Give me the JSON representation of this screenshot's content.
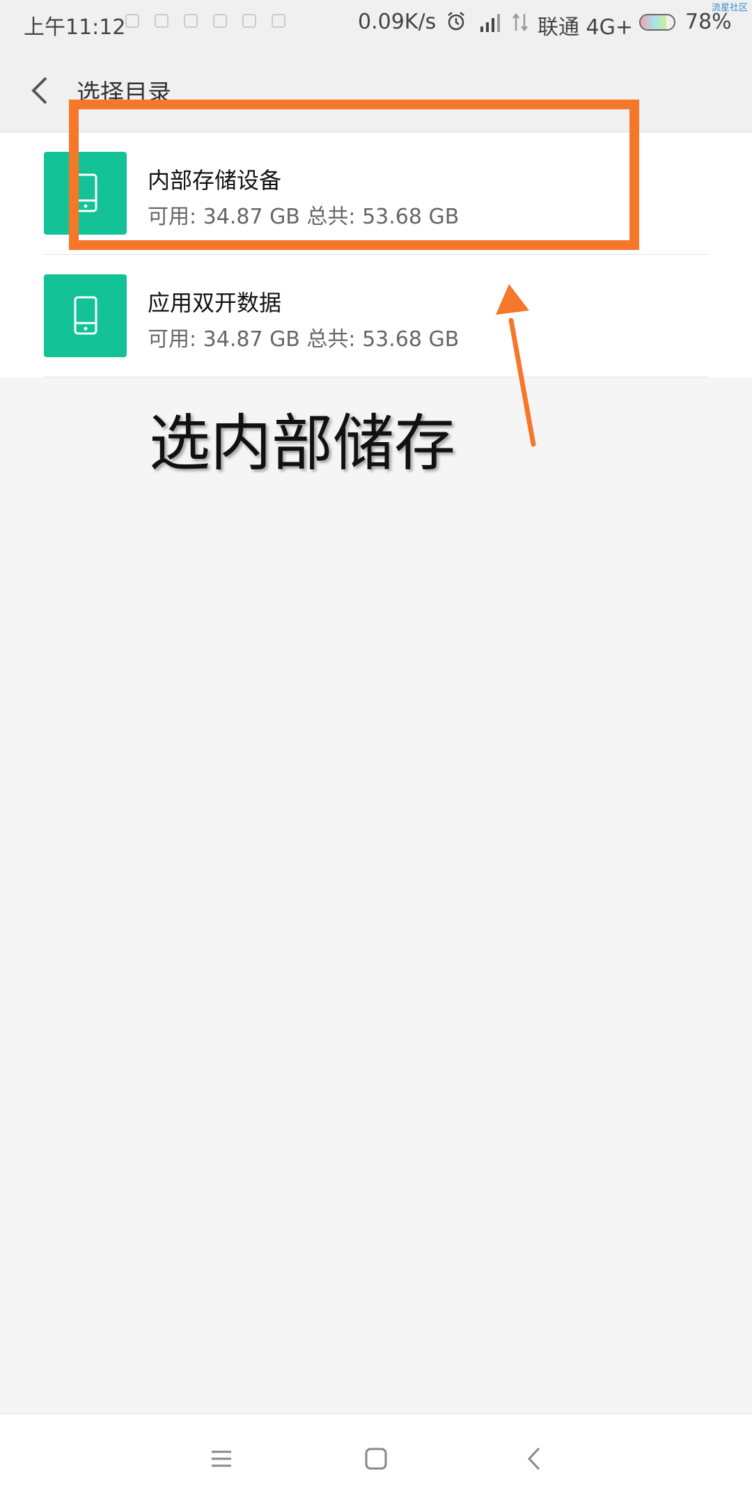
{
  "status_bar": {
    "time": "上午11:12",
    "network_speed": "0.09K/s",
    "carrier": "联通 4G+",
    "battery_percent": "78%",
    "battery_level": 0.78
  },
  "watermark": "流星社区",
  "header": {
    "title": "选择目录"
  },
  "storage_list": [
    {
      "name": "内部存储设备",
      "info": "可用: 34.87 GB 总共: 53.68 GB",
      "icon": "phone-icon"
    },
    {
      "name": "应用双开数据",
      "info": "可用: 34.87 GB 总共: 53.68 GB",
      "icon": "phone-icon"
    }
  ],
  "annotation": {
    "caption": "选内部储存",
    "color": "#f7772a"
  },
  "colors": {
    "icon_tile": "#13c297",
    "background": "#f5f5f5"
  },
  "navbar": {
    "icons": [
      "menu-icon",
      "home-icon",
      "back-icon"
    ]
  }
}
